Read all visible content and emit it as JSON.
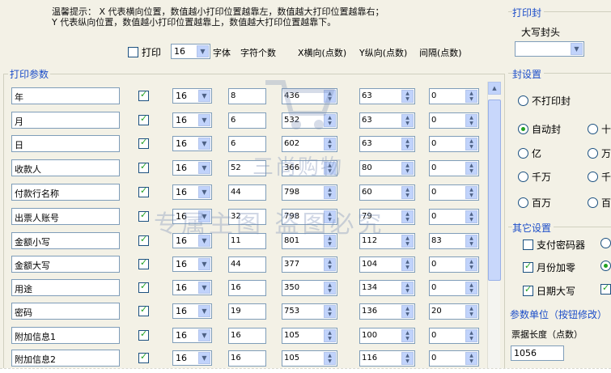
{
  "tip": {
    "line1": "温馨提示： X 代表横向位置，数值越小打印位置越靠左，数值越大打印位置越靠右；",
    "line2": "Y 代表纵向位置，数值越小打印位置越靠上，数值越大打印位置越靠下。"
  },
  "header": {
    "print_label": "打印",
    "font_value": "16",
    "col_font": "字体",
    "col_count": "字符个数",
    "col_x": "X横向(点数)",
    "col_y": "Y纵向(点数)",
    "col_gap": "间隔(点数)"
  },
  "group_title": "打印参数",
  "rows": [
    {
      "name": "年",
      "font": "16",
      "count": "8",
      "x": "436",
      "y": "63",
      "gap": "0"
    },
    {
      "name": "月",
      "font": "16",
      "count": "6",
      "x": "532",
      "y": "63",
      "gap": "0"
    },
    {
      "name": "日",
      "font": "16",
      "count": "6",
      "x": "602",
      "y": "63",
      "gap": "0"
    },
    {
      "name": "收款人",
      "font": "16",
      "count": "52",
      "x": "366",
      "y": "80",
      "gap": "0"
    },
    {
      "name": "付款行名称",
      "font": "16",
      "count": "44",
      "x": "798",
      "y": "60",
      "gap": "0"
    },
    {
      "name": "出票人账号",
      "font": "16",
      "count": "32",
      "x": "798",
      "y": "79",
      "gap": "0"
    },
    {
      "name": "金额小写",
      "font": "16",
      "count": "11",
      "x": "801",
      "y": "112",
      "gap": "83"
    },
    {
      "name": "金额大写",
      "font": "16",
      "count": "44",
      "x": "377",
      "y": "104",
      "gap": "0"
    },
    {
      "name": "用途",
      "font": "16",
      "count": "16",
      "x": "350",
      "y": "134",
      "gap": "0"
    },
    {
      "name": "密码",
      "font": "16",
      "count": "19",
      "x": "753",
      "y": "136",
      "gap": "20"
    },
    {
      "name": "附加信息1",
      "font": "16",
      "count": "16",
      "x": "105",
      "y": "100",
      "gap": "0"
    },
    {
      "name": "附加信息2",
      "font": "16",
      "count": "16",
      "x": "105",
      "y": "116",
      "gap": "0"
    }
  ],
  "watermark": {
    "line1": "三尚购物",
    "line2": "专属主图   盗图必究"
  },
  "right": {
    "print_seal_title": "打印封",
    "uppercase_seal_label": "大写封头",
    "seal_settings_title": "封设置",
    "no_seal": "不打印封",
    "auto_seal": "自动封",
    "ten": "十",
    "yi": "亿",
    "wan": "万",
    "qianwan": "千万",
    "qian": "千",
    "baiwan": "百万",
    "bai": "百",
    "other_settings_title": "其它设置",
    "pay_password": "支付密码器",
    "month_zero": "月份加零",
    "day_upper": "日期大写",
    "param_unit_title": "参数单位（按钮修改）",
    "bill_length_label": "票据长度（点数）",
    "bill_length_value": "1056"
  }
}
